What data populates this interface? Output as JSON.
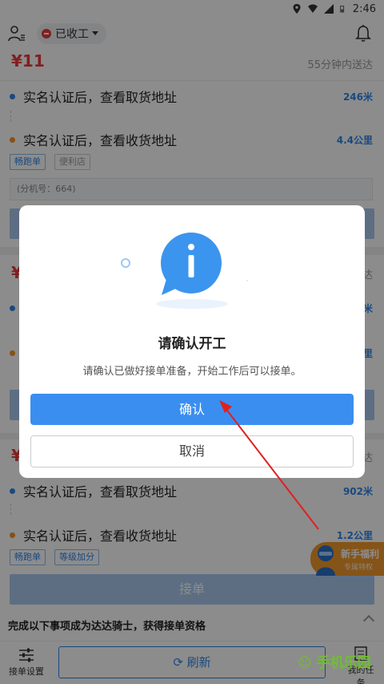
{
  "statusbar": {
    "time": "2:46"
  },
  "topbar": {
    "work_status": "已收工"
  },
  "orders": [
    {
      "price": "¥11",
      "eta": "55分钟内送达",
      "pickup": {
        "text": "实名认证后，查看取货地址",
        "distance": "246米"
      },
      "delivery": {
        "text": "实名认证后，查看收货地址",
        "distance": "4.4公里"
      },
      "tags": [
        "畅跑单",
        "便利店"
      ],
      "note": "(分机号：664)"
    },
    {
      "price": "¥",
      "eta": "达",
      "pickup": {
        "text": "实名认证后，查看取货地址",
        "distance": "902米"
      },
      "delivery": {
        "text": "实名认证后，查看收货地址",
        "distance": "1.2公里"
      },
      "tags": [
        "畅跑单",
        "等级加分"
      ]
    }
  ],
  "partial": {
    "price": "¥",
    "eta": "达",
    "dist1": "米",
    "dist2": "里",
    "eta2": "达"
  },
  "accept_label": "接单",
  "bottom": {
    "qualification": "完成以下事项成为达达骑士，获得接单资格",
    "settings_label": "接单设置",
    "refresh_label": "刷新",
    "tasks_label": "我的任务"
  },
  "promo": {
    "title": "新手福利",
    "subtitle": "专属特权"
  },
  "dialog": {
    "title": "请确认开工",
    "message": "请确认已做好接单准备，开始工作后可以接单。",
    "confirm": "确认",
    "cancel": "取消"
  },
  "watermark": "手机乐园",
  "colors": {
    "accent": "#3a8ef0",
    "price": "#e93b3b",
    "pickup_dot": "#2f86ea",
    "delivery_dot": "#f3942a",
    "arrow": "#e02020"
  },
  "icons": [
    "location-icon",
    "wifi-icon",
    "battery-icon",
    "user-list-icon",
    "bell-icon",
    "info-bubble-icon",
    "sliders-icon",
    "refresh-icon",
    "task-list-icon"
  ]
}
